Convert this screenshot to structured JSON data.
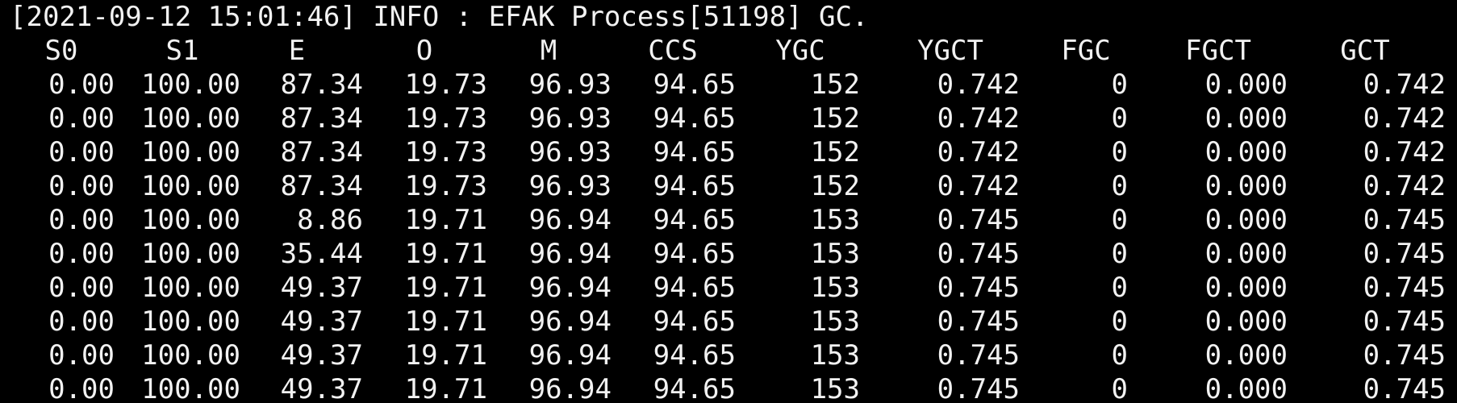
{
  "log": {
    "line": "[2021-09-12 15:01:46] INFO : EFAK Process[51198] GC."
  },
  "table": {
    "headers": [
      "S0",
      "S1",
      "E",
      "O",
      "M",
      "CCS",
      "YGC",
      "YGCT",
      "FGC",
      "FGCT",
      "GCT"
    ],
    "rows": [
      [
        "0.00",
        "100.00",
        "87.34",
        "19.73",
        "96.93",
        "94.65",
        "152",
        "0.742",
        "0",
        "0.000",
        "0.742"
      ],
      [
        "0.00",
        "100.00",
        "87.34",
        "19.73",
        "96.93",
        "94.65",
        "152",
        "0.742",
        "0",
        "0.000",
        "0.742"
      ],
      [
        "0.00",
        "100.00",
        "87.34",
        "19.73",
        "96.93",
        "94.65",
        "152",
        "0.742",
        "0",
        "0.000",
        "0.742"
      ],
      [
        "0.00",
        "100.00",
        "87.34",
        "19.73",
        "96.93",
        "94.65",
        "152",
        "0.742",
        "0",
        "0.000",
        "0.742"
      ],
      [
        "0.00",
        "100.00",
        "8.86",
        "19.71",
        "96.94",
        "94.65",
        "153",
        "0.745",
        "0",
        "0.000",
        "0.745"
      ],
      [
        "0.00",
        "100.00",
        "35.44",
        "19.71",
        "96.94",
        "94.65",
        "153",
        "0.745",
        "0",
        "0.000",
        "0.745"
      ],
      [
        "0.00",
        "100.00",
        "49.37",
        "19.71",
        "96.94",
        "94.65",
        "153",
        "0.745",
        "0",
        "0.000",
        "0.745"
      ],
      [
        "0.00",
        "100.00",
        "49.37",
        "19.71",
        "96.94",
        "94.65",
        "153",
        "0.745",
        "0",
        "0.000",
        "0.745"
      ],
      [
        "0.00",
        "100.00",
        "49.37",
        "19.71",
        "96.94",
        "94.65",
        "153",
        "0.745",
        "0",
        "0.000",
        "0.745"
      ],
      [
        "0.00",
        "100.00",
        "49.37",
        "19.71",
        "96.94",
        "94.65",
        "153",
        "0.745",
        "0",
        "0.000",
        "0.745"
      ]
    ]
  },
  "colors": {
    "background": "#000000",
    "text": "#f2f2f2"
  }
}
